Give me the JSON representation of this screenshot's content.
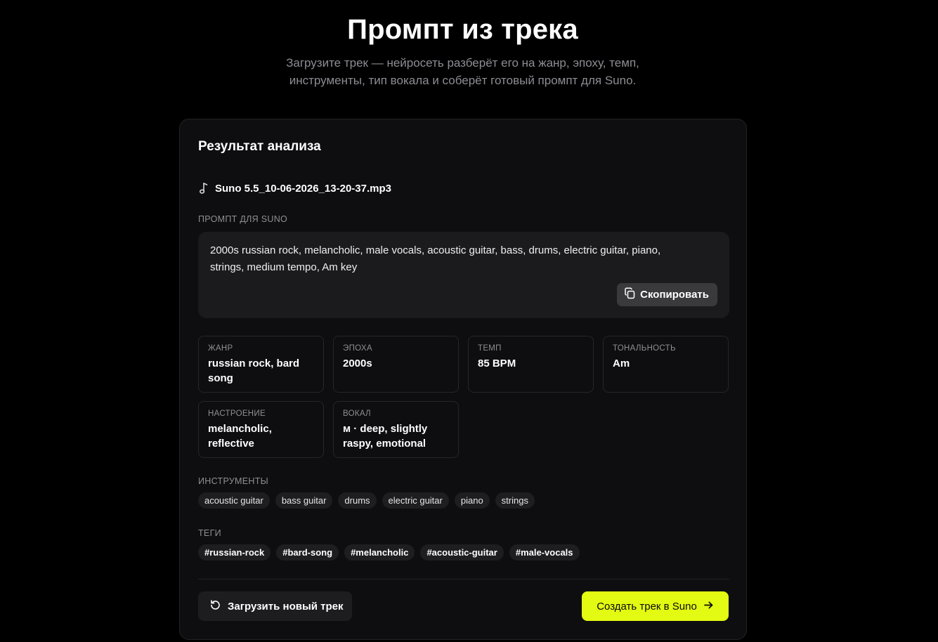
{
  "header": {
    "title": "Промпт из трека",
    "subtitle_line1": "Загрузите трек — нейросеть разберёт его на жанр, эпоху, темп,",
    "subtitle_line2": "инструменты, тип вокала и соберёт готовый промпт для Suno."
  },
  "result": {
    "title": "Результат анализа",
    "file_name": "Suno 5.5_10-06-2026_13-20-37.mp3",
    "file_icon": "music-note-icon",
    "prompt_label": "ПРОМПТ ДЛЯ SUNO",
    "prompt_line1": "2000s russian rock, melancholic, male vocals, acoustic guitar, bass, drums, electric guitar, piano,",
    "prompt_line2": "strings, medium tempo, Am key",
    "copy_label": "Скопировать",
    "copy_icon": "copy-icon"
  },
  "stats": [
    {
      "label": "ЖАНР",
      "value": "russian rock, bard song"
    },
    {
      "label": "ЭПОХА",
      "value": "2000s"
    },
    {
      "label": "ТЕМП",
      "value": "85 BPM"
    },
    {
      "label": "ТОНАЛЬНОСТЬ",
      "value": "Am"
    },
    {
      "label": "НАСТРОЕНИЕ",
      "value": "melancholic, reflective"
    },
    {
      "label": "ВОКАЛ",
      "value": "м · deep, slightly raspy, emotional"
    }
  ],
  "instruments": {
    "label": "ИНСТРУМЕНТЫ",
    "items": [
      "acoustic guitar",
      "bass guitar",
      "drums",
      "electric guitar",
      "piano",
      "strings"
    ]
  },
  "tags": {
    "label": "ТЕГИ",
    "items": [
      "#russian-rock",
      "#bard-song",
      "#melancholic",
      "#acoustic-guitar",
      "#male-vocals"
    ]
  },
  "actions": {
    "upload_label": "Загрузить новый трек",
    "upload_icon": "refresh-icon",
    "suno_label": "Создать трек в Suno",
    "suno_icon": "arrow-right-icon",
    "accent_color": "#e3fa12"
  }
}
